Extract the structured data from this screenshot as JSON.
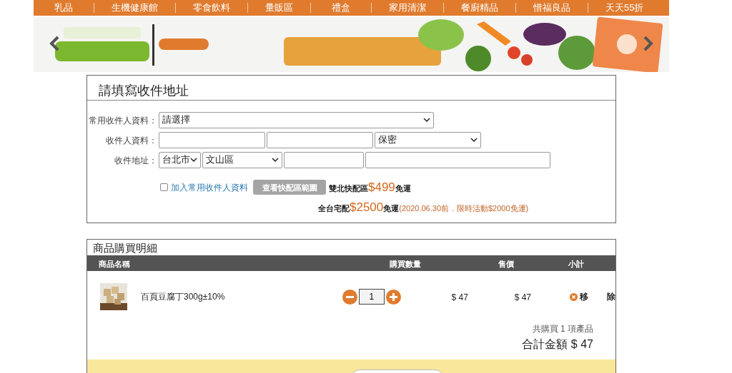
{
  "nav": [
    "乳品",
    "生機健康館",
    "零食飲料",
    "量販區",
    "禮盒",
    "家用清潔",
    "餐廚精品",
    "惜福良品",
    "天天55折"
  ],
  "address": {
    "title": "請填寫收件地址",
    "rows": [
      {
        "label": "常用收件人資料：",
        "fields": [
          {
            "kind": "select",
            "value": "請選擇"
          }
        ]
      },
      {
        "label": "收件人資料：",
        "fields": [
          {
            "kind": "input"
          },
          {
            "kind": "input"
          },
          {
            "kind": "select",
            "value": "保密"
          }
        ]
      },
      {
        "label": "收件地址：",
        "fields": [
          {
            "kind": "select",
            "value": "台北市"
          },
          {
            "kind": "select",
            "value": "文山區"
          },
          {
            "kind": "input"
          },
          {
            "kind": "input"
          }
        ]
      }
    ],
    "save": {
      "label": "加入常用收件人資料",
      "checked": false
    },
    "range_button": "查看快配區範圍",
    "shipping": [
      {
        "prefix": "雙北快配區",
        "amount": "$499",
        "suffix": "免運"
      },
      {
        "prefix": "全台宅配",
        "amount": "$2500",
        "suffix": "免運",
        "note": "(2020.06.30前．限時活動$2000免運)"
      }
    ]
  },
  "cart": {
    "title": "商品購買明細",
    "columns": [
      "商品名稱",
      "購買數量",
      "售價",
      "小計"
    ],
    "rows": [
      {
        "name": "百頁豆腐丁300g±10%",
        "quantity": "1",
        "price": "$ 47",
        "subtotal": "$ 47",
        "remove": [
          "移",
          "除"
        ]
      }
    ],
    "count": "共購買 1 項產品",
    "total": "合計金額 $ 47"
  }
}
